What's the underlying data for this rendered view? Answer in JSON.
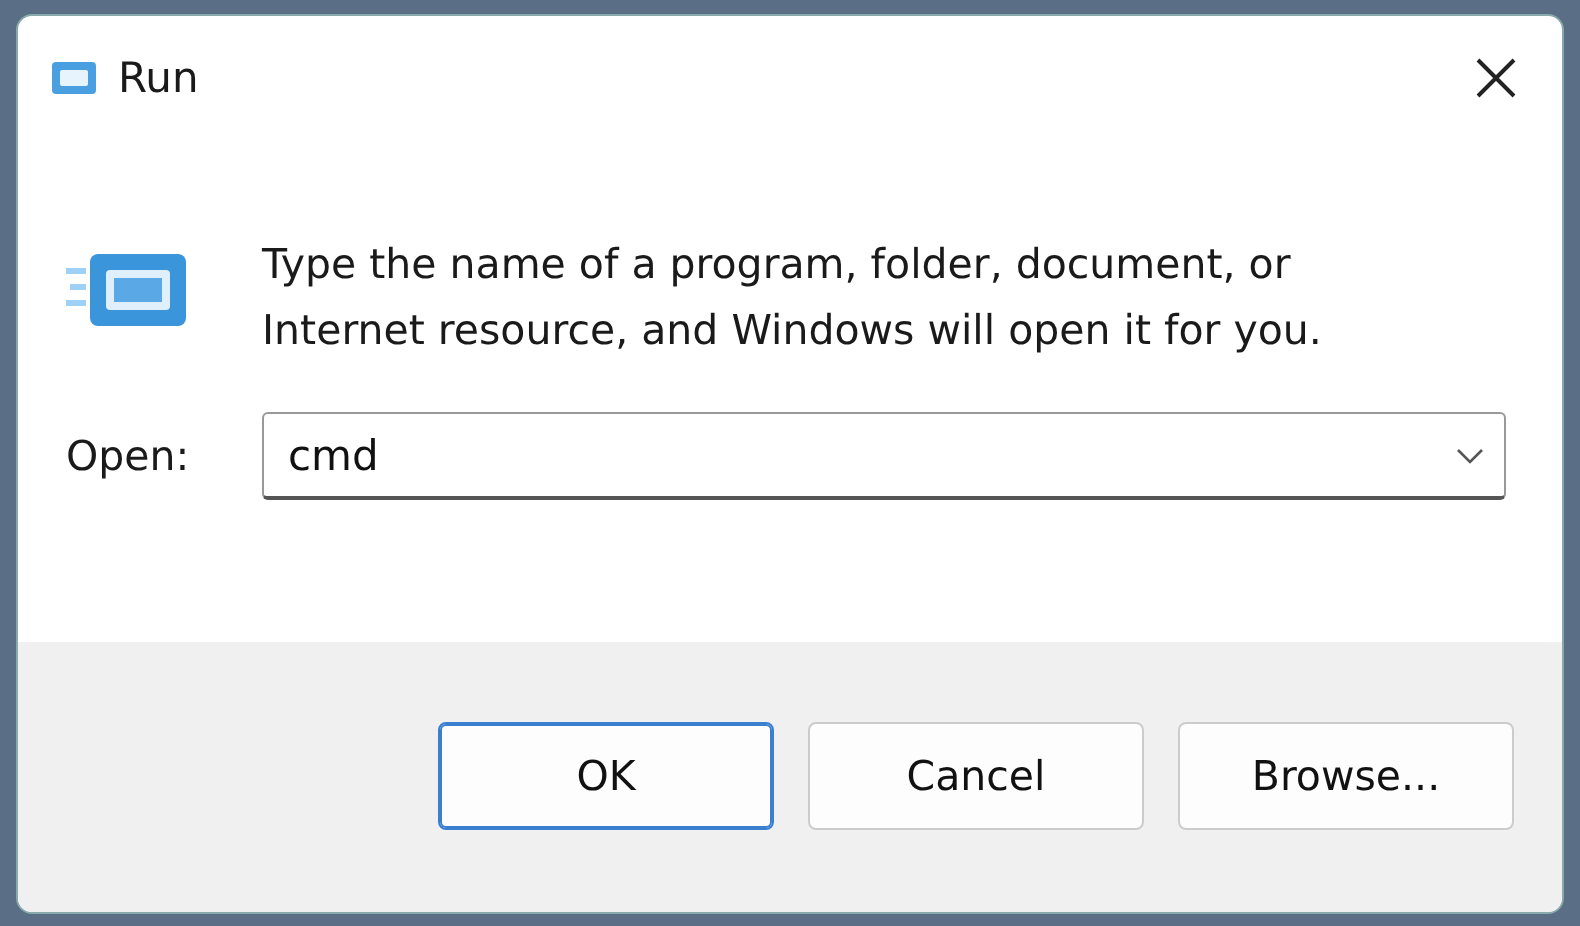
{
  "window": {
    "title": "Run"
  },
  "message": "Type the name of a program, folder, document, or Internet resource, and Windows will open it for you.",
  "open_field": {
    "label": "Open:",
    "value": "cmd"
  },
  "buttons": [
    {
      "label": "OK",
      "default": true
    },
    {
      "label": "Cancel",
      "default": false
    },
    {
      "label": "Browse...",
      "default": false
    }
  ]
}
